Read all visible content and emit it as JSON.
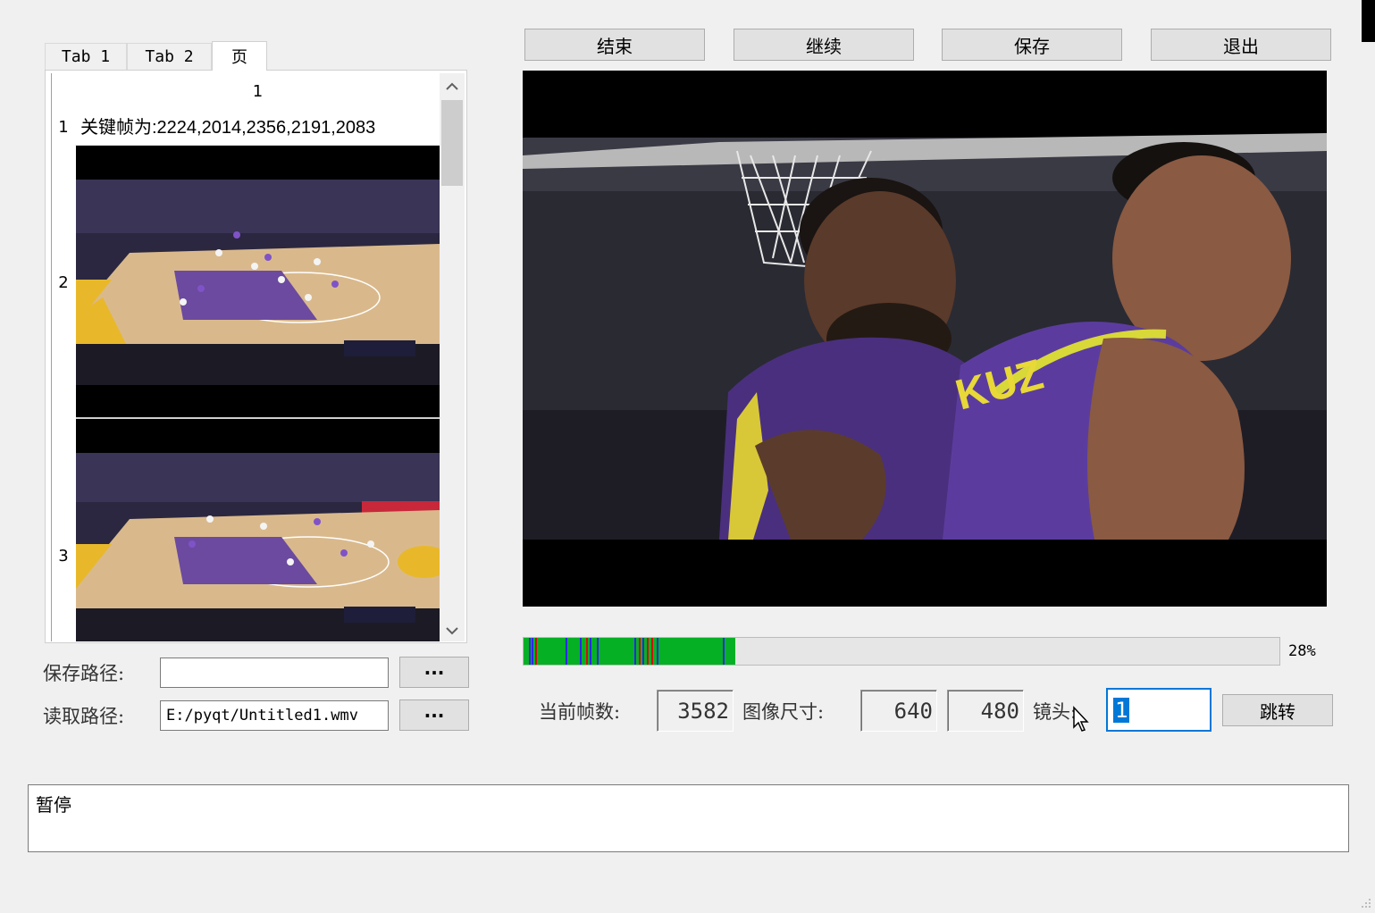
{
  "tabs": [
    {
      "label": "Tab 1"
    },
    {
      "label": "Tab 2"
    },
    {
      "label": "页"
    }
  ],
  "table": {
    "column_header": "1",
    "row_headers": [
      "1",
      "2",
      "3"
    ],
    "keyframe_text": "关键帧为:2224,2014,2356,2191,2083"
  },
  "left_form": {
    "save_path_label": "保存路径:",
    "save_path_value": "",
    "read_path_label": "读取路径:",
    "read_path_value": "E:/pyqt/Untitled1.wmv",
    "browse_label": "···"
  },
  "toolbar": {
    "end_label": "结束",
    "continue_label": "继续",
    "save_label": "保存",
    "exit_label": "退出"
  },
  "progress": {
    "value_percent": 28,
    "label": "28%",
    "colors": {
      "fill": "#06b025",
      "marker_blue": "#2a2adf",
      "marker_red": "#d01010"
    },
    "markers": [
      {
        "pos": 0.007,
        "color": "blue"
      },
      {
        "pos": 0.011,
        "color": "blue"
      },
      {
        "pos": 0.015,
        "color": "red"
      },
      {
        "pos": 0.055,
        "color": "blue"
      },
      {
        "pos": 0.075,
        "color": "blue"
      },
      {
        "pos": 0.083,
        "color": "red"
      },
      {
        "pos": 0.088,
        "color": "blue"
      },
      {
        "pos": 0.097,
        "color": "blue"
      },
      {
        "pos": 0.147,
        "color": "blue"
      },
      {
        "pos": 0.152,
        "color": "red"
      },
      {
        "pos": 0.157,
        "color": "blue"
      },
      {
        "pos": 0.163,
        "color": "red"
      },
      {
        "pos": 0.169,
        "color": "red"
      },
      {
        "pos": 0.176,
        "color": "blue"
      },
      {
        "pos": 0.264,
        "color": "blue"
      }
    ]
  },
  "info": {
    "frame_label": "当前帧数:",
    "frame_value": "3582",
    "size_label": "图像尺寸:",
    "width_value": "640",
    "height_value": "480",
    "shot_label": "镜头:",
    "shot_value": "1",
    "jump_label": "跳转"
  },
  "status": {
    "text": "暂停"
  }
}
